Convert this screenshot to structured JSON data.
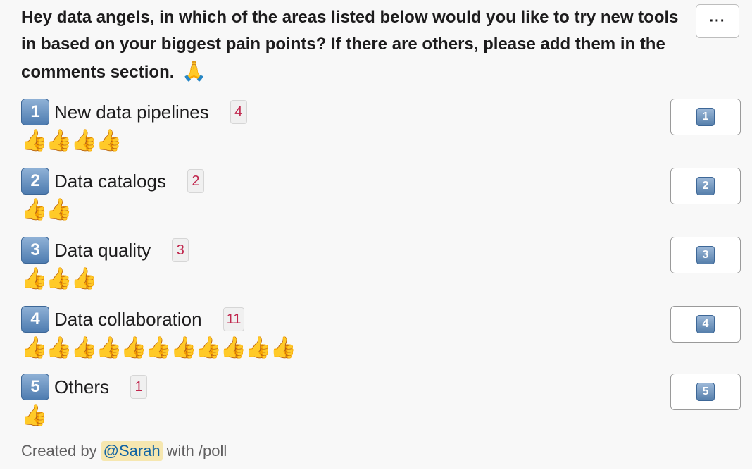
{
  "poll": {
    "question": "Hey data angels, in which of the areas listed below would you like to try new tools in based on your biggest pain points? If there are others, please add them in the comments section.",
    "question_emoji": "🙏",
    "menu_label": "···",
    "vote_emoji": "👍",
    "options": [
      {
        "number": "1",
        "label": "New data pipelines",
        "count": "4",
        "thumbs": "👍👍👍👍"
      },
      {
        "number": "2",
        "label": "Data catalogs",
        "count": "2",
        "thumbs": "👍👍"
      },
      {
        "number": "3",
        "label": "Data quality",
        "count": "3",
        "thumbs": "👍👍👍"
      },
      {
        "number": "4",
        "label": "Data collaboration",
        "count": "11",
        "thumbs": "👍👍👍👍👍👍👍👍👍👍👍"
      },
      {
        "number": "5",
        "label": "Others",
        "count": "1",
        "thumbs": "👍"
      }
    ],
    "footer": {
      "prefix": "Created by",
      "author": "@Sarah",
      "suffix": "with /poll"
    }
  },
  "colors": {
    "card_bg": "#f8f8f8",
    "number_badge": "#4e7cb0",
    "count_text": "#c0264d",
    "mention_bg": "#f6e7b0",
    "mention_text": "#1264a3"
  }
}
